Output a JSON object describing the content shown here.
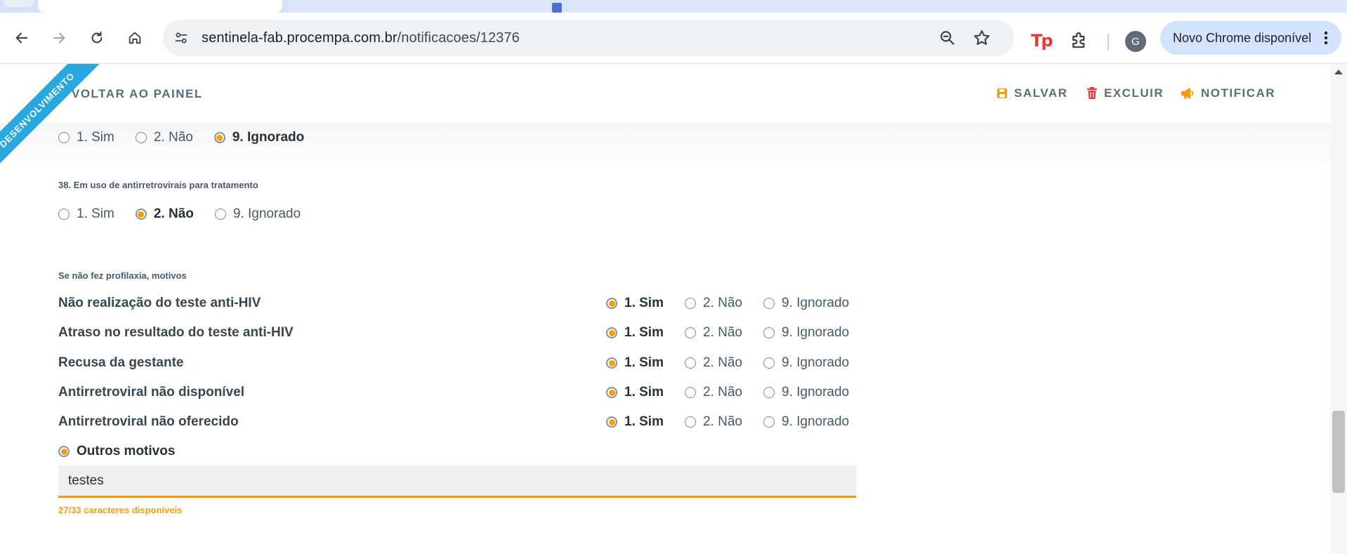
{
  "browser": {
    "url_host": "sentinela-fab.procempa.com.br",
    "url_path": "/notificacoes/12376",
    "update_label": "Novo Chrome disponível",
    "profile_initial": "G",
    "extension_label": "Tp"
  },
  "header": {
    "back_label": "VOLTAR AO PAINEL",
    "save_label": "SALVAR",
    "delete_label": "EXCLUIR",
    "notify_label": "NOTIFICAR",
    "ribbon": "DESENVOLVIMENTO"
  },
  "q_prev": {
    "options": [
      "1. Sim",
      "2. Não",
      "9. Ignorado"
    ],
    "selected": "9. Ignorado"
  },
  "q38": {
    "label": "38. Em uso de antirretrovirais para tratamento",
    "options": [
      "1. Sim",
      "2. Não",
      "9. Ignorado"
    ],
    "selected": "2. Não"
  },
  "motivos": {
    "section_label": "Se não fez profilaxia, motivos",
    "options": [
      "1. Sim",
      "2. Não",
      "9. Ignorado"
    ],
    "items": [
      {
        "label": "Não realização do teste anti-HIV",
        "selected": "1. Sim"
      },
      {
        "label": "Atraso no resultado do teste anti-HIV",
        "selected": "1. Sim"
      },
      {
        "label": "Recusa da gestante",
        "selected": "1. Sim"
      },
      {
        "label": "Antirretroviral não disponível",
        "selected": "1. Sim"
      },
      {
        "label": "Antirretroviral não oferecido",
        "selected": "1. Sim"
      }
    ],
    "outros_label": "Outros motivos",
    "outros_value": "testes",
    "counter": "27/33 caracteres disponíveis"
  },
  "colors": {
    "accent": "#f39c12",
    "ribbon": "#29a8e0",
    "delete": "#e53935"
  }
}
